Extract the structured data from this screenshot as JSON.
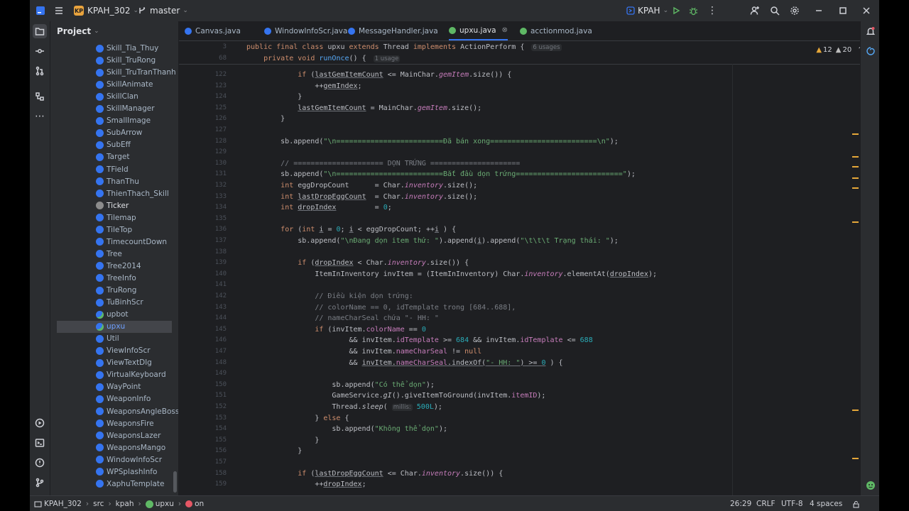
{
  "titlebar": {
    "project_badge": "KP",
    "project_name": "KPAH_302",
    "branch": "master",
    "run_config": "KPAH",
    "accent": "#3574f0"
  },
  "project_panel": {
    "title": "Project",
    "items": [
      {
        "label": "Skill_Tia_Thuy",
        "icon": "class-icon"
      },
      {
        "label": "Skill_TruRong",
        "icon": "class-icon"
      },
      {
        "label": "Skill_TruTranThanh",
        "icon": "class-icon"
      },
      {
        "label": "SkillAnimate",
        "icon": "class-icon"
      },
      {
        "label": "SkillClan",
        "icon": "class-icon"
      },
      {
        "label": "SkillManager",
        "icon": "class-icon"
      },
      {
        "label": "SmallImage",
        "icon": "class-icon"
      },
      {
        "label": "SubArrow",
        "icon": "class-icon"
      },
      {
        "label": "SubEff",
        "icon": "class-icon"
      },
      {
        "label": "Target",
        "icon": "class-icon"
      },
      {
        "label": "TField",
        "icon": "class-icon"
      },
      {
        "label": "ThanThu",
        "icon": "class-icon"
      },
      {
        "label": "ThienThach_Skill",
        "icon": "class-icon"
      },
      {
        "label": "Ticker",
        "icon": "interface-icon"
      },
      {
        "label": "Tilemap",
        "icon": "class-icon"
      },
      {
        "label": "TileTop",
        "icon": "class-icon"
      },
      {
        "label": "TimecountDown",
        "icon": "class-icon"
      },
      {
        "label": "Tree",
        "icon": "class-icon"
      },
      {
        "label": "Tree2014",
        "icon": "class-icon"
      },
      {
        "label": "TreeInfo",
        "icon": "class-icon"
      },
      {
        "label": "TruRong",
        "icon": "class-icon"
      },
      {
        "label": "TuBinhScr",
        "icon": "class-icon"
      },
      {
        "label": "upbot",
        "icon": "runnable-class-icon"
      },
      {
        "label": "upxu",
        "icon": "runnable-class-icon",
        "selected": true
      },
      {
        "label": "Util",
        "icon": "class-icon"
      },
      {
        "label": "ViewInfoScr",
        "icon": "class-icon"
      },
      {
        "label": "ViewTextDlg",
        "icon": "class-icon"
      },
      {
        "label": "VirtualKeyboard",
        "icon": "class-icon"
      },
      {
        "label": "WayPoint",
        "icon": "class-icon"
      },
      {
        "label": "WeaponInfo",
        "icon": "class-icon"
      },
      {
        "label": "WeaponsAngleBoss",
        "icon": "class-icon"
      },
      {
        "label": "WeaponsFire",
        "icon": "class-icon"
      },
      {
        "label": "WeaponsLazer",
        "icon": "class-icon"
      },
      {
        "label": "WeaponsMango",
        "icon": "class-icon"
      },
      {
        "label": "WindowInfoScr",
        "icon": "class-icon"
      },
      {
        "label": "WPSplashInfo",
        "icon": "class-icon"
      },
      {
        "label": "XaphuTemplate",
        "icon": "class-icon"
      }
    ]
  },
  "tabs": [
    {
      "label": "Canvas.java",
      "icon": "class-icon"
    },
    {
      "label": "WindowInfoScr.java",
      "icon": "class-icon"
    },
    {
      "label": "MessageHandler.java",
      "icon": "class-icon"
    },
    {
      "label": "upxu.java",
      "icon": "runnable-class-icon",
      "active": true
    },
    {
      "label": "acctionmod.java",
      "icon": "runnable-class-icon"
    }
  ],
  "inspections": {
    "warnings": "12",
    "weak_warnings": "20"
  },
  "sticky": [
    {
      "ln": "3",
      "segs": [
        [
          "kw",
          "public final class "
        ],
        [
          "",
          "upxu "
        ],
        [
          "kw",
          "extends "
        ],
        [
          "",
          "Thread "
        ],
        [
          "kw",
          "implements "
        ],
        [
          "",
          "ActionPerform {"
        ]
      ],
      "hint": "6 usages"
    },
    {
      "ln": "68",
      "segs": [
        [
          "",
          "    "
        ],
        [
          "kw",
          "private void "
        ],
        [
          "fn",
          "runOnce"
        ],
        [
          "",
          "() {"
        ]
      ],
      "hint": "1 usage"
    }
  ],
  "code": [
    {
      "ln": "122",
      "segs": [
        [
          "",
          "            "
        ],
        [
          "kw",
          "if "
        ],
        [
          "",
          "("
        ],
        [
          "ul",
          "lastGemItemCount"
        ],
        [
          "",
          " <= MainChar."
        ],
        [
          "fld it",
          "gemItem"
        ],
        [
          "",
          ".size()) {"
        ]
      ]
    },
    {
      "ln": "123",
      "segs": [
        [
          "",
          "                ++"
        ],
        [
          "ul",
          "gemIndex"
        ],
        [
          "",
          ";"
        ]
      ]
    },
    {
      "ln": "124",
      "segs": [
        [
          "",
          "            }"
        ]
      ]
    },
    {
      "ln": "125",
      "segs": [
        [
          "",
          "            "
        ],
        [
          "ul",
          "lastGemItemCount"
        ],
        [
          "",
          " = MainChar."
        ],
        [
          "fld it",
          "gemItem"
        ],
        [
          "",
          ".size();"
        ]
      ]
    },
    {
      "ln": "126",
      "segs": [
        [
          "",
          "        }"
        ]
      ]
    },
    {
      "ln": "127",
      "segs": []
    },
    {
      "ln": "128",
      "segs": [
        [
          "",
          "        sb.append("
        ],
        [
          "str",
          "\"\\n=========================Đã bán xong=========================\\n\""
        ],
        [
          "",
          ");"
        ]
      ]
    },
    {
      "ln": "129",
      "segs": []
    },
    {
      "ln": "130",
      "segs": [
        [
          "cm",
          "        // ===================== DỌN TRỨNG ====================="
        ]
      ]
    },
    {
      "ln": "131",
      "segs": [
        [
          "",
          "        sb.append("
        ],
        [
          "str",
          "\"\\n=========================Bắt đầu dọn trứng=========================\""
        ],
        [
          "",
          ");"
        ]
      ]
    },
    {
      "ln": "132",
      "segs": [
        [
          "",
          "        "
        ],
        [
          "kw",
          "int "
        ],
        [
          "",
          "eggDropCount      = Char."
        ],
        [
          "fld it",
          "inventory"
        ],
        [
          "",
          ".size();"
        ]
      ]
    },
    {
      "ln": "133",
      "segs": [
        [
          "",
          "        "
        ],
        [
          "kw",
          "int "
        ],
        [
          "ul",
          "lastDropEggCount"
        ],
        [
          "",
          "  = Char."
        ],
        [
          "fld it",
          "inventory"
        ],
        [
          "",
          ".size();"
        ]
      ]
    },
    {
      "ln": "134",
      "segs": [
        [
          "",
          "        "
        ],
        [
          "kw",
          "int "
        ],
        [
          "ul",
          "dropIndex"
        ],
        [
          "",
          "         = "
        ],
        [
          "num",
          "0"
        ],
        [
          "",
          ";"
        ]
      ]
    },
    {
      "ln": "135",
      "segs": []
    },
    {
      "ln": "136",
      "segs": [
        [
          "",
          "        "
        ],
        [
          "kw",
          "for "
        ],
        [
          "",
          "("
        ],
        [
          "kw",
          "int "
        ],
        [
          "ul",
          "i"
        ],
        [
          "",
          " = "
        ],
        [
          "num",
          "0"
        ],
        [
          "",
          "; "
        ],
        [
          "ul",
          "i"
        ],
        [
          "",
          " < eggDropCount; ++"
        ],
        [
          "ul",
          "i"
        ],
        [
          "",
          " ) {"
        ]
      ]
    },
    {
      "ln": "137",
      "segs": [
        [
          "",
          "            sb.append("
        ],
        [
          "str",
          "\"\\nĐang dọn item thứ: \""
        ],
        [
          "",
          ").append("
        ],
        [
          "ul",
          "i"
        ],
        [
          "",
          ").append("
        ],
        [
          "str",
          "\"\\t\\t\\t Trạng thái: \""
        ],
        [
          "",
          ");"
        ]
      ]
    },
    {
      "ln": "138",
      "segs": []
    },
    {
      "ln": "139",
      "segs": [
        [
          "",
          "            "
        ],
        [
          "kw",
          "if "
        ],
        [
          "",
          "("
        ],
        [
          "ul",
          "dropIndex"
        ],
        [
          "",
          " < Char."
        ],
        [
          "fld it",
          "inventory"
        ],
        [
          "",
          ".size()) {"
        ]
      ]
    },
    {
      "ln": "140",
      "segs": [
        [
          "",
          "                ItemInInventory invItem = (ItemInInventory) Char."
        ],
        [
          "fld it",
          "inventory"
        ],
        [
          "",
          ".elementAt("
        ],
        [
          "ul",
          "dropIndex"
        ],
        [
          "",
          ");"
        ]
      ]
    },
    {
      "ln": "141",
      "segs": []
    },
    {
      "ln": "142",
      "segs": [
        [
          "cm",
          "                // Điều kiện dọn trứng:"
        ]
      ]
    },
    {
      "ln": "143",
      "segs": [
        [
          "cm",
          "                // colorName == 0, idTemplate trong [684..688],"
        ]
      ]
    },
    {
      "ln": "144",
      "segs": [
        [
          "cm",
          "                // nameCharSeal chứa \"- HH: \""
        ]
      ]
    },
    {
      "ln": "145",
      "segs": [
        [
          "",
          "                "
        ],
        [
          "kw",
          "if "
        ],
        [
          "",
          "(invItem."
        ],
        [
          "fld",
          "colorName"
        ],
        [
          "",
          " == "
        ],
        [
          "num",
          "0"
        ]
      ]
    },
    {
      "ln": "146",
      "segs": [
        [
          "",
          "                        && invItem."
        ],
        [
          "fld",
          "idTemplate"
        ],
        [
          "",
          " >= "
        ],
        [
          "num",
          "684"
        ],
        [
          "",
          " && invItem."
        ],
        [
          "fld",
          "idTemplate"
        ],
        [
          "",
          " <= "
        ],
        [
          "num",
          "688"
        ]
      ]
    },
    {
      "ln": "147",
      "segs": [
        [
          "",
          "                        && invItem."
        ],
        [
          "fld",
          "nameCharSeal"
        ],
        [
          "",
          " != "
        ],
        [
          "kw",
          "null"
        ]
      ]
    },
    {
      "ln": "148",
      "segs": [
        [
          "",
          "                        && "
        ],
        [
          "ul",
          "invItem."
        ],
        [
          "fld ul",
          "nameCharSeal"
        ],
        [
          "ul",
          ".indexOf("
        ],
        [
          "str ul",
          "\"- HH: \""
        ],
        [
          "ul",
          ") >= "
        ],
        [
          "num ul",
          "0"
        ],
        [
          "",
          " ) {"
        ]
      ]
    },
    {
      "ln": "149",
      "segs": []
    },
    {
      "ln": "150",
      "segs": [
        [
          "",
          "                    sb.append("
        ],
        [
          "str",
          "\"Có thể dọn\""
        ],
        [
          "",
          ");"
        ]
      ]
    },
    {
      "ln": "151",
      "segs": [
        [
          "",
          "                    GameService."
        ],
        [
          "it",
          "gI"
        ],
        [
          "",
          "().giveItemToGround(invItem."
        ],
        [
          "fld",
          "itemID"
        ],
        [
          "",
          ");"
        ]
      ]
    },
    {
      "ln": "152",
      "segs": [
        [
          "",
          "                    Thread."
        ],
        [
          "it",
          "sleep"
        ],
        [
          "",
          "( "
        ],
        [
          "hint",
          "millis:"
        ],
        [
          "",
          " "
        ],
        [
          "num",
          "500L"
        ],
        [
          "",
          ");"
        ]
      ]
    },
    {
      "ln": "153",
      "segs": [
        [
          "",
          "                } "
        ],
        [
          "kw",
          "else "
        ],
        [
          "",
          "{"
        ]
      ]
    },
    {
      "ln": "154",
      "segs": [
        [
          "",
          "                    sb.append("
        ],
        [
          "str",
          "\"Không thể dọn\""
        ],
        [
          "",
          ");"
        ]
      ]
    },
    {
      "ln": "155",
      "segs": [
        [
          "",
          "                }"
        ]
      ]
    },
    {
      "ln": "156",
      "segs": [
        [
          "",
          "            }"
        ]
      ]
    },
    {
      "ln": "157",
      "segs": []
    },
    {
      "ln": "158",
      "segs": [
        [
          "",
          "            "
        ],
        [
          "kw",
          "if "
        ],
        [
          "",
          "("
        ],
        [
          "ul",
          "lastDropEggCount"
        ],
        [
          "",
          " <= Char."
        ],
        [
          "fld it",
          "inventory"
        ],
        [
          "",
          ".size()) {"
        ]
      ]
    },
    {
      "ln": "159",
      "segs": [
        [
          "",
          "                ++"
        ],
        [
          "ul",
          "dropIndex"
        ],
        [
          "",
          ";"
        ]
      ]
    }
  ],
  "statusbar": {
    "breadcrumbs": [
      "KPAH_302",
      "src",
      "kpah",
      "upxu",
      "on"
    ],
    "position": "26:29",
    "line_sep": "CRLF",
    "encoding": "UTF-8",
    "indent": "4 spaces"
  },
  "colors": {
    "keyword": "#cf8e6d",
    "string": "#6aab73",
    "comment": "#7a7e85",
    "field": "#c77dbb",
    "number": "#2aacb8",
    "function": "#56a8f5"
  }
}
